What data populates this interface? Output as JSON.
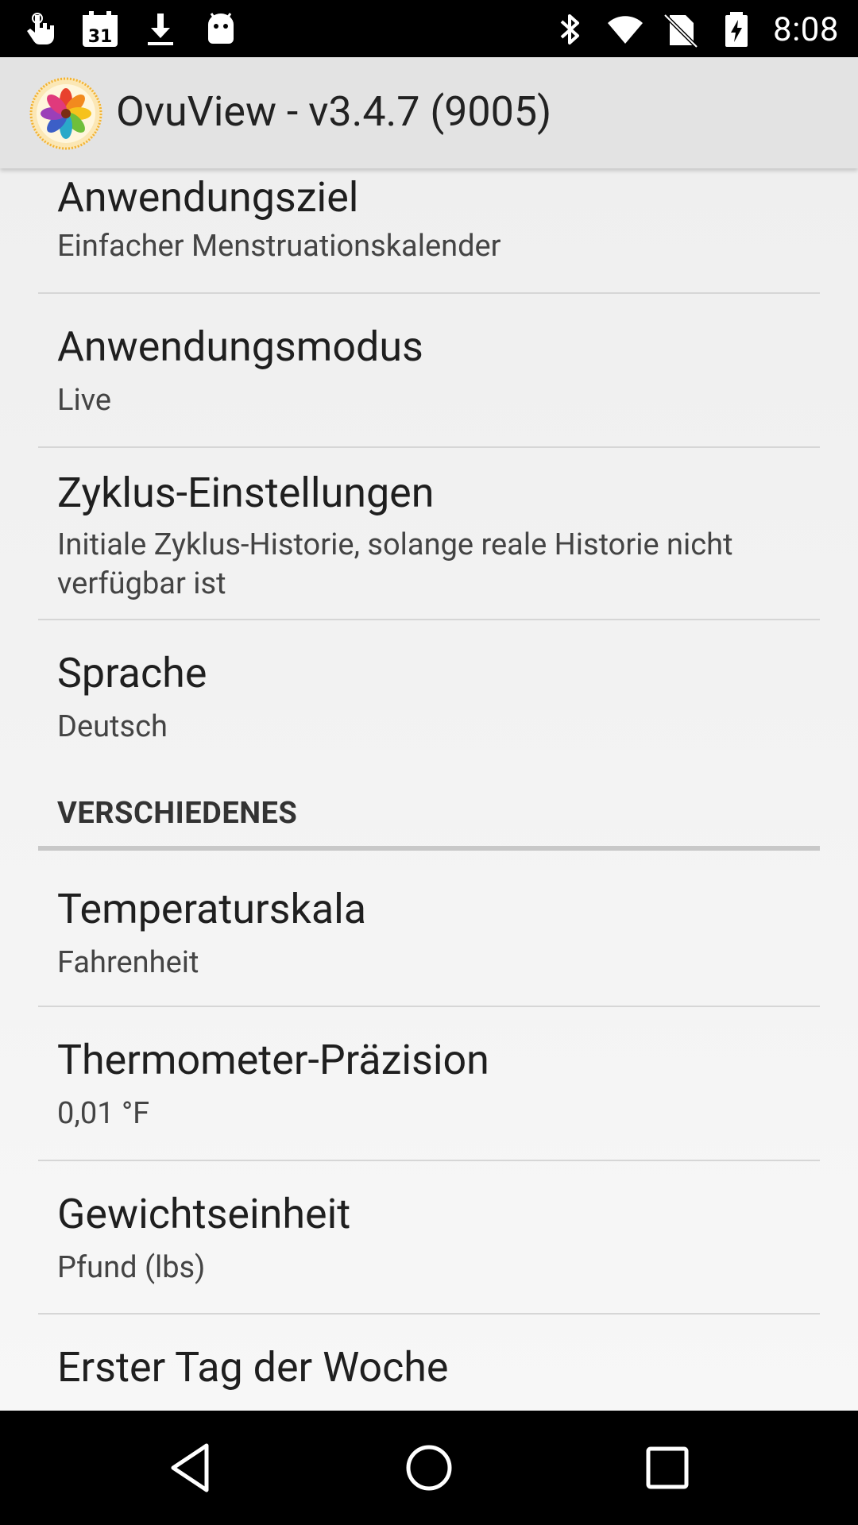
{
  "status_bar": {
    "time": "8:08",
    "left_icons": [
      "touch-icon",
      "calendar-icon",
      "download-icon",
      "android-icon"
    ],
    "calendar_day": "31",
    "right_icons": [
      "bluetooth-icon",
      "wifi-icon",
      "no-sim-icon",
      "battery-charging-icon"
    ]
  },
  "app_bar": {
    "title": "OvuView - v3.4.7 (9005)",
    "logo_icon": "ovuview-flower-icon"
  },
  "preferences": [
    {
      "title": "Anwendungsziel",
      "summary": "Einfacher Menstruationskalender"
    },
    {
      "title": "Anwendungsmodus",
      "summary": "Live"
    },
    {
      "title": "Zyklus-Einstellungen",
      "summary": "Initiale Zyklus-Historie, solange reale Historie nicht verfügbar ist"
    },
    {
      "title": "Sprache",
      "summary": "Deutsch"
    }
  ],
  "section_misc": {
    "header": "VERSCHIEDENES",
    "items": [
      {
        "title": "Temperaturskala",
        "summary": "Fahrenheit"
      },
      {
        "title": "Thermometer-Präzision",
        "summary": "0,01 °F"
      },
      {
        "title": "Gewichtseinheit",
        "summary": "Pfund (lbs)"
      },
      {
        "title": "Erster Tag der Woche",
        "summary": ""
      }
    ]
  },
  "nav_bar": {
    "buttons": [
      "back-icon",
      "home-icon",
      "recents-icon"
    ]
  },
  "colors": {
    "status_bar": "#000000",
    "app_bar": "#e3e3e3",
    "background": "#f2f2f2",
    "text_primary": "#1f1f1f",
    "text_secondary": "#444444"
  }
}
